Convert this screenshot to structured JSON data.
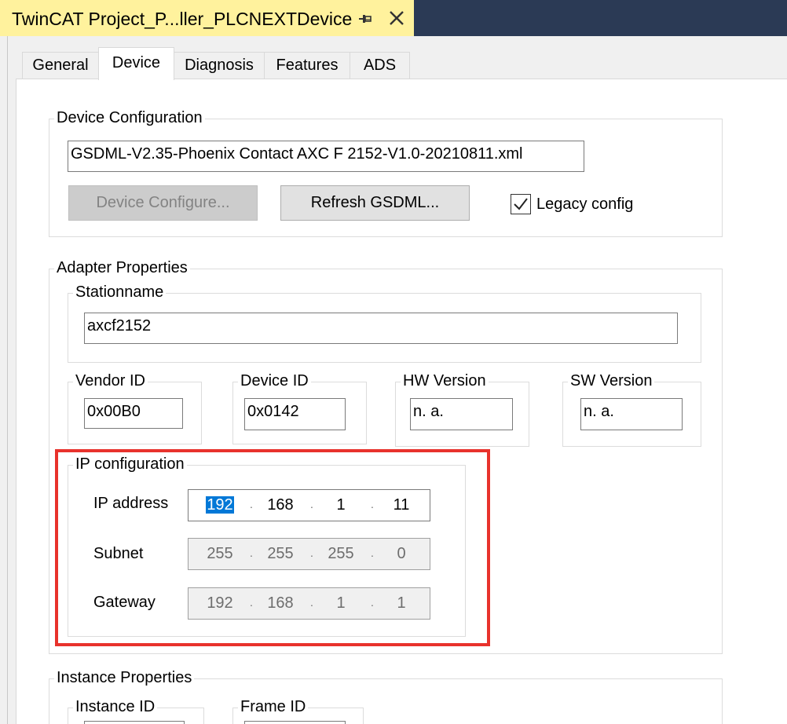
{
  "window": {
    "title": "TwinCAT Project_P...ller_PLCNEXTDevice"
  },
  "tabs": [
    {
      "label": "General"
    },
    {
      "label": "Device"
    },
    {
      "label": "Diagnosis"
    },
    {
      "label": "Features"
    },
    {
      "label": "ADS"
    }
  ],
  "active_tab": "Device",
  "device_configuration": {
    "legend": "Device Configuration",
    "file_value": "GSDML-V2.35-Phoenix Contact AXC F 2152-V1.0-20210811.xml",
    "configure_button": "Device Configure...",
    "refresh_button": "Refresh GSDML...",
    "legacy_label": "Legacy config",
    "legacy_checked": true
  },
  "adapter_properties": {
    "legend": "Adapter Properties",
    "stationname_legend": "Stationname",
    "stationname_value": "axcf2152",
    "vendor_legend": "Vendor ID",
    "vendor_value": "0x00B0",
    "device_legend": "Device ID",
    "device_value": "0x0142",
    "hw_legend": "HW Version",
    "hw_value": "n. a.",
    "sw_legend": "SW Version",
    "sw_value": "n. a."
  },
  "ip_configuration": {
    "legend": "IP configuration",
    "ip_label": "IP address",
    "ip": [
      "192",
      "168",
      "1",
      "11"
    ],
    "subnet_label": "Subnet",
    "subnet": [
      "255",
      "255",
      "255",
      "0"
    ],
    "gateway_label": "Gateway",
    "gateway": [
      "192",
      "168",
      "1",
      "1"
    ],
    "dot": "."
  },
  "instance_properties": {
    "legend": "Instance Properties",
    "instance_id_legend": "Instance ID",
    "frame_id_legend": "Frame ID"
  },
  "colors": {
    "doc_tab": "#fff29d",
    "highlight": "#e8322c",
    "selection": "#0078d7"
  }
}
